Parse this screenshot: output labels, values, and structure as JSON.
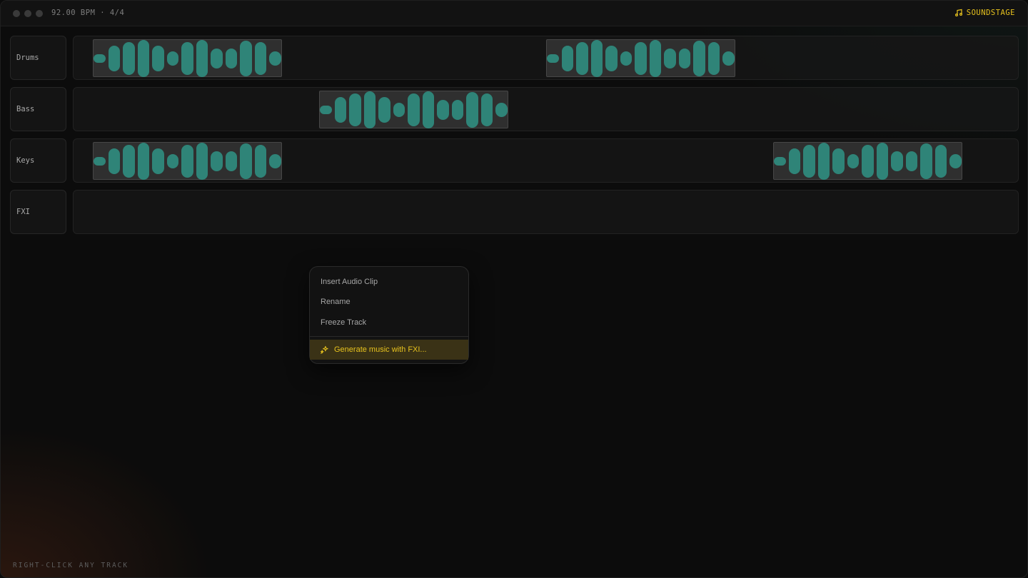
{
  "titlebar": {
    "tempo_meter": "92.00 BPM · 4/4",
    "brand": "SOUNDSTAGE",
    "brand_icon": "music-note-icon"
  },
  "tracks": [
    {
      "name": "Drums"
    },
    {
      "name": "Bass"
    },
    {
      "name": "Keys"
    },
    {
      "name": "FXI"
    }
  ],
  "context_menu": {
    "items": [
      "Insert Audio Clip",
      "Rename",
      "Freeze Track"
    ],
    "highlight": "Generate music with FXI...",
    "highlight_icon": "sparkle-icon"
  },
  "footer_hint": "RIGHT-CLICK ANY TRACK",
  "colors": {
    "accent": "#e7c21e",
    "waveform": "#2f8478",
    "clip_bg": "#2f2f2f"
  }
}
